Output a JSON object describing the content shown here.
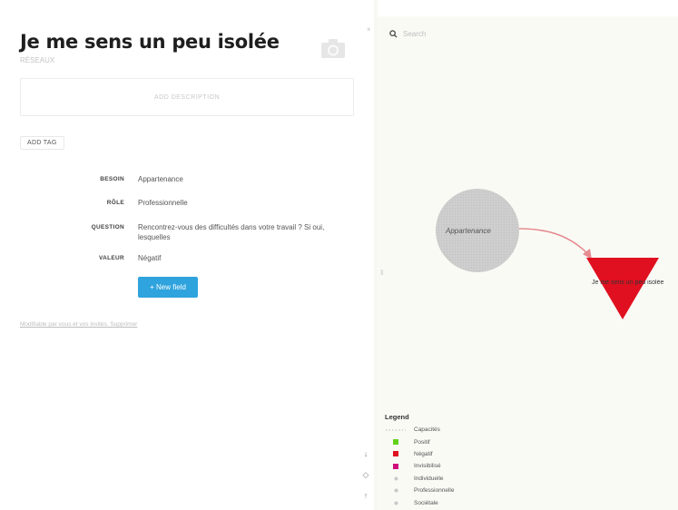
{
  "node": {
    "title": "Je me sens un peu isolée",
    "subtitle": "RÉSEAUX"
  },
  "description": {
    "placeholder": "ADD DESCRIPTION"
  },
  "tags": {
    "add_label": "ADD TAG"
  },
  "properties": [
    {
      "key": "BESOIN",
      "value": "Appartenance"
    },
    {
      "key": "RÔLE",
      "value": "Professionnelle"
    },
    {
      "key": "QUESTION",
      "value": "Rencontrez-vous des difficultés dans votre travail ? Si oui, lesquelles"
    },
    {
      "key": "VALEUR",
      "value": "Négatif"
    }
  ],
  "new_field_label": "+ New field",
  "footer_link": "Modifiable par vous et vos invités. Supprimer",
  "graph": {
    "search_placeholder": "Search",
    "nodes": [
      {
        "label": "Appartenance",
        "shape": "circle",
        "color": "#cfcfcf"
      },
      {
        "label": "Je me sens un peu isolée",
        "shape": "triangle",
        "color": "#e01020"
      }
    ],
    "edge_color": "#e58a8f"
  },
  "legend": {
    "title": "Legend",
    "items": [
      {
        "label": "Capacités",
        "marker": "dots",
        "color": "#c8c8c8"
      },
      {
        "label": "Positif",
        "marker": "square",
        "color": "#63d11a"
      },
      {
        "label": "Négatif",
        "marker": "square",
        "color": "#e01020"
      },
      {
        "label": "Invisibilisé",
        "marker": "square",
        "color": "#d0107a"
      },
      {
        "label": "Individuelle",
        "marker": "dot",
        "color": "#c8c8c8"
      },
      {
        "label": "Professionnelle",
        "marker": "dot",
        "color": "#c8c8c8"
      },
      {
        "label": "Sociétale",
        "marker": "dot",
        "color": "#c8c8c8"
      }
    ]
  },
  "zoom_controls": [
    "↓",
    "◇",
    "↑"
  ]
}
